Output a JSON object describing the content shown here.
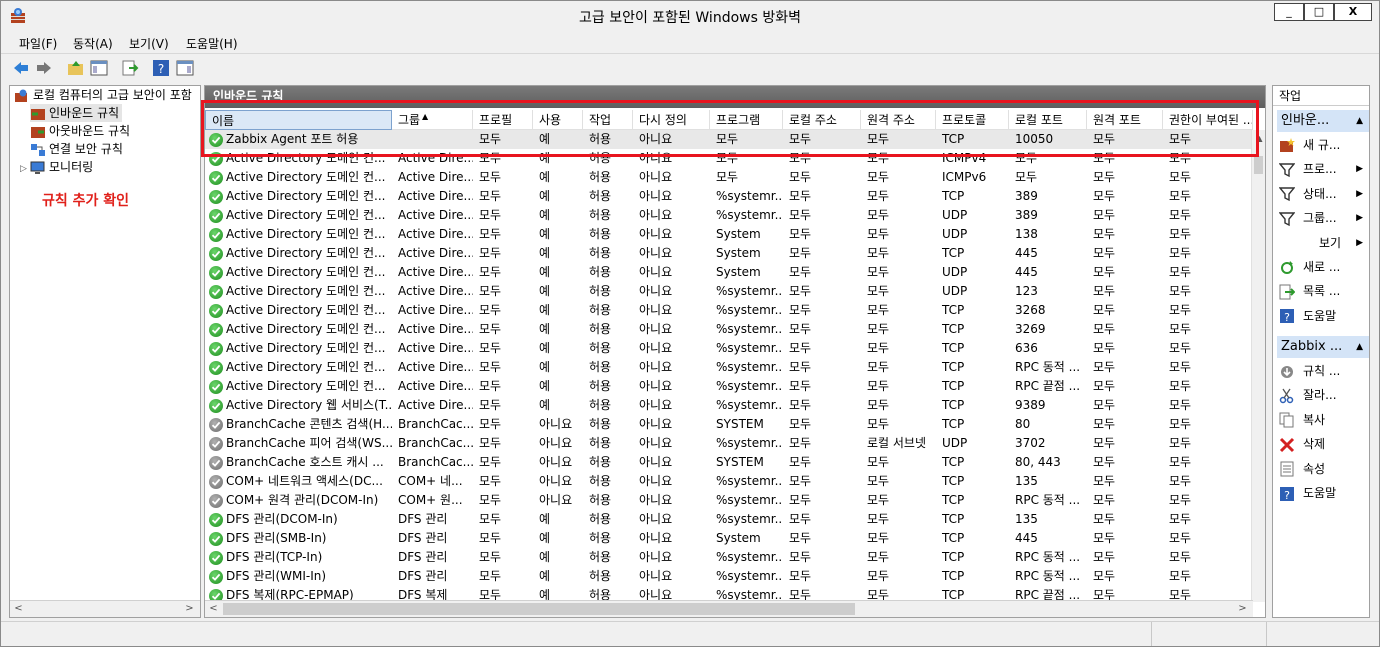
{
  "window": {
    "title": "고급 보안이 포함된 Windows 방화벽",
    "min": "_",
    "max": "□",
    "close": "X"
  },
  "menu": [
    "파일(F)",
    "동작(A)",
    "보기(V)",
    "도움말(H)"
  ],
  "toolbar": [
    "back-icon",
    "forward-icon",
    "up-folder-icon",
    "show-hide-console-tree-icon",
    "export-icon",
    "help-icon",
    "show-hide-action-pane-icon"
  ],
  "tree": {
    "root": "로컬 컴퓨터의 고급 보안이 포함",
    "items": [
      "인바운드 규칙",
      "아웃바운드 규칙",
      "연결 보안 규칙",
      "모니터링"
    ],
    "note": "규칙 추가 확인"
  },
  "center": {
    "header": "인바운드 규칙",
    "columns": [
      "이름",
      "그룹",
      "프로필",
      "사용",
      "작업",
      "다시 정의",
      "프로그램",
      "로컬 주소",
      "원격 주소",
      "프로토콜",
      "로컬 포트",
      "원격 포트",
      "권한이 부여된 ..."
    ],
    "rows": [
      {
        "on": true,
        "cells": [
          "Zabbix Agent 포트 허용",
          "",
          "모두",
          "예",
          "허용",
          "아니요",
          "모두",
          "모두",
          "모두",
          "TCP",
          "10050",
          "모두",
          "모두"
        ]
      },
      {
        "on": true,
        "cells": [
          "Active Directory 도메인 컨...",
          "Active Dire...",
          "모두",
          "예",
          "허용",
          "아니요",
          "모두",
          "모두",
          "모두",
          "ICMPv4",
          "모두",
          "모두",
          "모두"
        ]
      },
      {
        "on": true,
        "cells": [
          "Active Directory 도메인 컨...",
          "Active Dire...",
          "모두",
          "예",
          "허용",
          "아니요",
          "모두",
          "모두",
          "모두",
          "ICMPv6",
          "모두",
          "모두",
          "모두"
        ]
      },
      {
        "on": true,
        "cells": [
          "Active Directory 도메인 컨...",
          "Active Dire...",
          "모두",
          "예",
          "허용",
          "아니요",
          "%systemr...",
          "모두",
          "모두",
          "TCP",
          "389",
          "모두",
          "모두"
        ]
      },
      {
        "on": true,
        "cells": [
          "Active Directory 도메인 컨...",
          "Active Dire...",
          "모두",
          "예",
          "허용",
          "아니요",
          "%systemr...",
          "모두",
          "모두",
          "UDP",
          "389",
          "모두",
          "모두"
        ]
      },
      {
        "on": true,
        "cells": [
          "Active Directory 도메인 컨...",
          "Active Dire...",
          "모두",
          "예",
          "허용",
          "아니요",
          "System",
          "모두",
          "모두",
          "UDP",
          "138",
          "모두",
          "모두"
        ]
      },
      {
        "on": true,
        "cells": [
          "Active Directory 도메인 컨...",
          "Active Dire...",
          "모두",
          "예",
          "허용",
          "아니요",
          "System",
          "모두",
          "모두",
          "TCP",
          "445",
          "모두",
          "모두"
        ]
      },
      {
        "on": true,
        "cells": [
          "Active Directory 도메인 컨...",
          "Active Dire...",
          "모두",
          "예",
          "허용",
          "아니요",
          "System",
          "모두",
          "모두",
          "UDP",
          "445",
          "모두",
          "모두"
        ]
      },
      {
        "on": true,
        "cells": [
          "Active Directory 도메인 컨...",
          "Active Dire...",
          "모두",
          "예",
          "허용",
          "아니요",
          "%systemr...",
          "모두",
          "모두",
          "UDP",
          "123",
          "모두",
          "모두"
        ]
      },
      {
        "on": true,
        "cells": [
          "Active Directory 도메인 컨...",
          "Active Dire...",
          "모두",
          "예",
          "허용",
          "아니요",
          "%systemr...",
          "모두",
          "모두",
          "TCP",
          "3268",
          "모두",
          "모두"
        ]
      },
      {
        "on": true,
        "cells": [
          "Active Directory 도메인 컨...",
          "Active Dire...",
          "모두",
          "예",
          "허용",
          "아니요",
          "%systemr...",
          "모두",
          "모두",
          "TCP",
          "3269",
          "모두",
          "모두"
        ]
      },
      {
        "on": true,
        "cells": [
          "Active Directory 도메인 컨...",
          "Active Dire...",
          "모두",
          "예",
          "허용",
          "아니요",
          "%systemr...",
          "모두",
          "모두",
          "TCP",
          "636",
          "모두",
          "모두"
        ]
      },
      {
        "on": true,
        "cells": [
          "Active Directory 도메인 컨...",
          "Active Dire...",
          "모두",
          "예",
          "허용",
          "아니요",
          "%systemr...",
          "모두",
          "모두",
          "TCP",
          "RPC 동적 ...",
          "모두",
          "모두"
        ]
      },
      {
        "on": true,
        "cells": [
          "Active Directory 도메인 컨...",
          "Active Dire...",
          "모두",
          "예",
          "허용",
          "아니요",
          "%systemr...",
          "모두",
          "모두",
          "TCP",
          "RPC 끝점 ...",
          "모두",
          "모두"
        ]
      },
      {
        "on": true,
        "cells": [
          "Active Directory 웹 서비스(T...",
          "Active Dire...",
          "모두",
          "예",
          "허용",
          "아니요",
          "%systemr...",
          "모두",
          "모두",
          "TCP",
          "9389",
          "모두",
          "모두"
        ]
      },
      {
        "on": false,
        "cells": [
          "BranchCache 콘텐츠 검색(H...",
          "BranchCac...",
          "모두",
          "아니요",
          "허용",
          "아니요",
          "SYSTEM",
          "모두",
          "모두",
          "TCP",
          "80",
          "모두",
          "모두"
        ]
      },
      {
        "on": false,
        "cells": [
          "BranchCache 피어 검색(WS...",
          "BranchCac...",
          "모두",
          "아니요",
          "허용",
          "아니요",
          "%systemr...",
          "모두",
          "로컬 서브넷",
          "UDP",
          "3702",
          "모두",
          "모두"
        ]
      },
      {
        "on": false,
        "cells": [
          "BranchCache 호스트 캐시 ...",
          "BranchCac...",
          "모두",
          "아니요",
          "허용",
          "아니요",
          "SYSTEM",
          "모두",
          "모두",
          "TCP",
          "80, 443",
          "모두",
          "모두"
        ]
      },
      {
        "on": false,
        "cells": [
          "COM+ 네트워크 액세스(DC...",
          "COM+ 네...",
          "모두",
          "아니요",
          "허용",
          "아니요",
          "%systemr...",
          "모두",
          "모두",
          "TCP",
          "135",
          "모두",
          "모두"
        ]
      },
      {
        "on": false,
        "cells": [
          "COM+ 원격 관리(DCOM-In)",
          "COM+ 원...",
          "모두",
          "아니요",
          "허용",
          "아니요",
          "%systemr...",
          "모두",
          "모두",
          "TCP",
          "RPC 동적 ...",
          "모두",
          "모두"
        ]
      },
      {
        "on": true,
        "cells": [
          "DFS 관리(DCOM-In)",
          "DFS 관리",
          "모두",
          "예",
          "허용",
          "아니요",
          "%systemr...",
          "모두",
          "모두",
          "TCP",
          "135",
          "모두",
          "모두"
        ]
      },
      {
        "on": true,
        "cells": [
          "DFS 관리(SMB-In)",
          "DFS 관리",
          "모두",
          "예",
          "허용",
          "아니요",
          "System",
          "모두",
          "모두",
          "TCP",
          "445",
          "모두",
          "모두"
        ]
      },
      {
        "on": true,
        "cells": [
          "DFS 관리(TCP-In)",
          "DFS 관리",
          "모두",
          "예",
          "허용",
          "아니요",
          "%systemr...",
          "모두",
          "모두",
          "TCP",
          "RPC 동적 ...",
          "모두",
          "모두"
        ]
      },
      {
        "on": true,
        "cells": [
          "DFS 관리(WMI-In)",
          "DFS 관리",
          "모두",
          "예",
          "허용",
          "아니요",
          "%systemr...",
          "모두",
          "모두",
          "TCP",
          "RPC 동적 ...",
          "모두",
          "모두"
        ]
      },
      {
        "on": true,
        "cells": [
          "DFS 복제(RPC-EPMAP)",
          "DFS 복제",
          "모두",
          "예",
          "허용",
          "아니요",
          "%systemr...",
          "모두",
          "모두",
          "TCP",
          "RPC 끝점 ...",
          "모두",
          "모두"
        ]
      }
    ]
  },
  "actions": {
    "header": "작업",
    "section1": "인바운...",
    "items1": [
      {
        "icon": "new-rule-icon",
        "label": "새 규..."
      },
      {
        "icon": "filter-icon",
        "label": "프로...",
        "arrow": true
      },
      {
        "icon": "filter-icon",
        "label": "상태...",
        "arrow": true
      },
      {
        "icon": "filter-icon",
        "label": "그룹...",
        "arrow": true
      },
      {
        "icon": "",
        "label": "보기",
        "arrow": true
      },
      {
        "icon": "refresh-icon",
        "label": "새로 ..."
      },
      {
        "icon": "export-list-icon",
        "label": "목록 ..."
      },
      {
        "icon": "help-icon",
        "label": "도움말"
      }
    ],
    "section2": "Zabbix ...",
    "items2": [
      {
        "icon": "disable-rule-icon",
        "label": "규칙 ..."
      },
      {
        "icon": "cut-icon",
        "label": "잘라..."
      },
      {
        "icon": "copy-icon",
        "label": "복사"
      },
      {
        "icon": "delete-icon",
        "label": "삭제"
      },
      {
        "icon": "properties-icon",
        "label": "속성"
      },
      {
        "icon": "help-icon",
        "label": "도움말"
      }
    ]
  },
  "colors": {
    "highlight": "#e8141e",
    "note": "#e0201a",
    "section": "#d4e4f7"
  }
}
